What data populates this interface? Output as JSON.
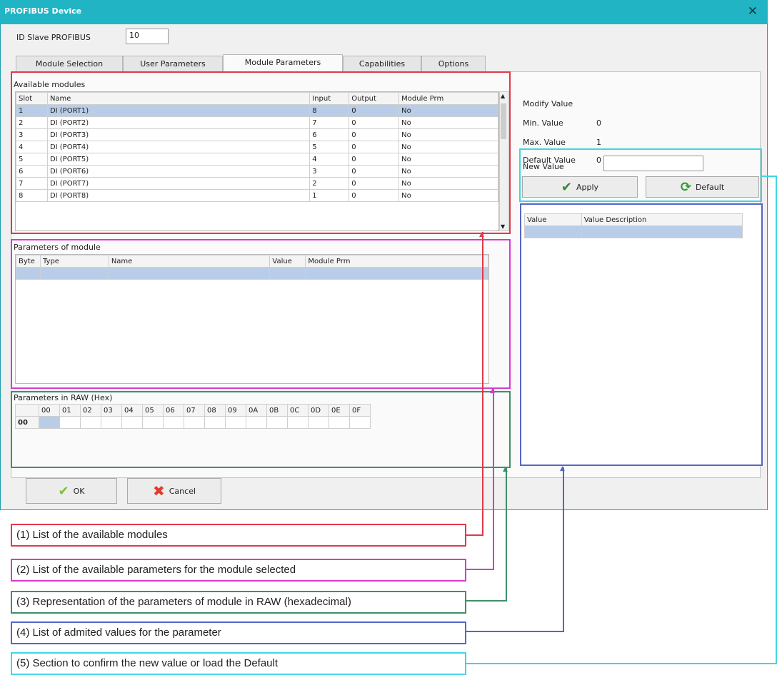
{
  "window": {
    "title": "PROFIBUS Device",
    "close_glyph": "✕"
  },
  "slave": {
    "label": "ID Slave PROFIBUS",
    "value": "10"
  },
  "tabs": [
    {
      "label": "Module Selection"
    },
    {
      "label": "User Parameters"
    },
    {
      "label": "Module Parameters"
    },
    {
      "label": "Capabilities"
    },
    {
      "label": "Options"
    }
  ],
  "modules": {
    "title": "Available modules",
    "columns": [
      "Slot",
      "Name",
      "Input",
      "Output",
      "Module Prm"
    ],
    "rows": [
      [
        "1",
        "DI (PORT1)",
        "8",
        "0",
        "No"
      ],
      [
        "2",
        "DI (PORT2)",
        "7",
        "0",
        "No"
      ],
      [
        "3",
        "DI (PORT3)",
        "6",
        "0",
        "No"
      ],
      [
        "4",
        "DI (PORT4)",
        "5",
        "0",
        "No"
      ],
      [
        "5",
        "DI (PORT5)",
        "4",
        "0",
        "No"
      ],
      [
        "6",
        "DI (PORT6)",
        "3",
        "0",
        "No"
      ],
      [
        "7",
        "DI (PORT7)",
        "2",
        "0",
        "No"
      ],
      [
        "8",
        "DI (PORT8)",
        "1",
        "0",
        "No"
      ]
    ]
  },
  "params": {
    "title": "Parameters of module",
    "columns": [
      "Byte",
      "Type",
      "Name",
      "Value",
      "Module Prm"
    ]
  },
  "raw": {
    "title": "Parameters in RAW (Hex)",
    "columns": [
      "00",
      "01",
      "02",
      "03",
      "04",
      "05",
      "06",
      "07",
      "08",
      "09",
      "0A",
      "0B",
      "0C",
      "0D",
      "0E",
      "0F"
    ],
    "row_label": "00"
  },
  "modify": {
    "title": "Modify Value",
    "min_label": "Min. Value",
    "min_value": "0",
    "max_label": "Max. Value",
    "max_value": "1",
    "default_label": "Default Value",
    "default_value": "0",
    "new_label": "New Value",
    "new_value": "",
    "apply": "Apply",
    "default_button": "Default"
  },
  "values_table": {
    "columns": [
      "Value",
      "Value Description"
    ]
  },
  "footer": {
    "ok": "OK",
    "cancel": "Cancel"
  },
  "captions": [
    "(1) List of the available modules",
    "(2) List of the available parameters for the module selected",
    "(3) Representation of the parameters of module in RAW (hexadecimal)",
    "(4) List of admited values for the parameter",
    "(5) Section to confirm the new value or load the Default"
  ],
  "colors": {
    "red": "#e0394a",
    "magenta": "#d63ad2",
    "green": "#3f8f6a",
    "blue": "#5566c8",
    "cyan": "#40d6e0"
  }
}
